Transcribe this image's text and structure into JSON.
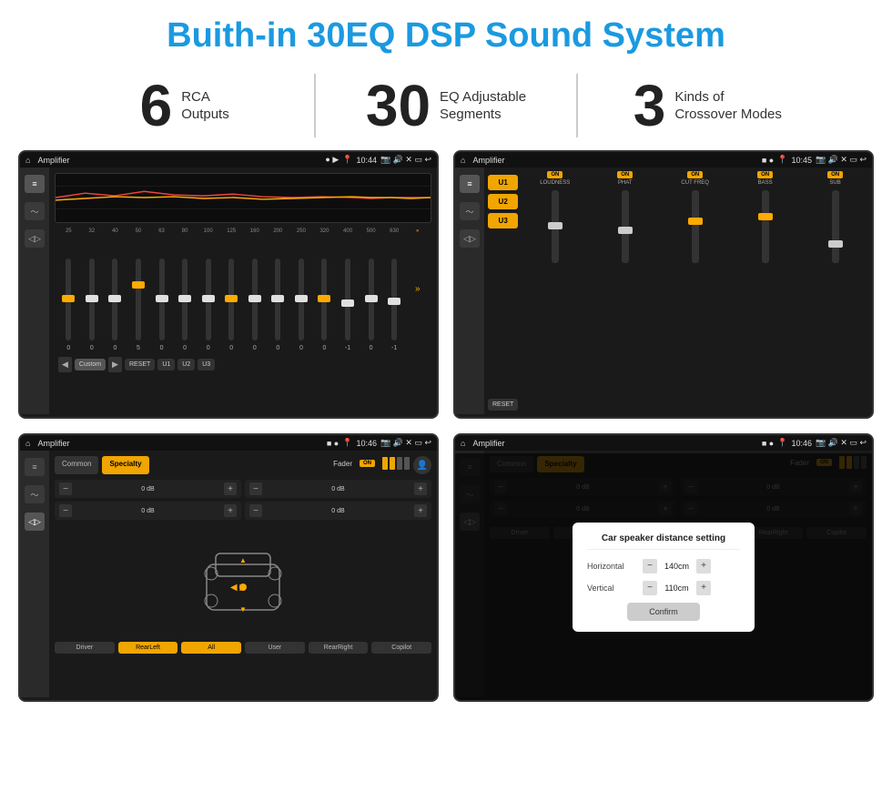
{
  "header": {
    "title": "Buith-in 30EQ DSP Sound System"
  },
  "stats": [
    {
      "number": "6",
      "label": "RCA\nOutputs"
    },
    {
      "number": "30",
      "label": "EQ Adjustable\nSegments"
    },
    {
      "number": "3",
      "label": "Kinds of\nCrossover Modes"
    }
  ],
  "screens": [
    {
      "id": "screen1",
      "status": {
        "title": "Amplifier",
        "time": "10:44"
      },
      "type": "eq"
    },
    {
      "id": "screen2",
      "status": {
        "title": "Amplifier",
        "time": "10:45"
      },
      "type": "crossover"
    },
    {
      "id": "screen3",
      "status": {
        "title": "Amplifier",
        "time": "10:46"
      },
      "type": "fader"
    },
    {
      "id": "screen4",
      "status": {
        "title": "Amplifier",
        "time": "10:46"
      },
      "type": "fader-dialog"
    }
  ],
  "eq": {
    "freqs": [
      "25",
      "32",
      "40",
      "50",
      "63",
      "80",
      "100",
      "125",
      "160",
      "200",
      "250",
      "320",
      "400",
      "500",
      "630"
    ],
    "vals": [
      "0",
      "0",
      "0",
      "5",
      "0",
      "0",
      "0",
      "0",
      "0",
      "0",
      "0",
      "0",
      "-1",
      "0",
      "-1"
    ],
    "slider_positions": [
      50,
      50,
      50,
      30,
      50,
      50,
      50,
      50,
      50,
      50,
      50,
      50,
      60,
      50,
      55
    ],
    "preset_labels": [
      "Custom",
      "RESET",
      "U1",
      "U2",
      "U3"
    ]
  },
  "crossover": {
    "presets": [
      "U1",
      "U2",
      "U3"
    ],
    "channels": [
      {
        "name": "LOUDNESS",
        "on": true
      },
      {
        "name": "PHAT",
        "on": true
      },
      {
        "name": "CUT FREQ",
        "on": true
      },
      {
        "name": "BASS",
        "on": true
      },
      {
        "name": "SUB",
        "on": true
      }
    ],
    "reset_label": "RESET"
  },
  "fader": {
    "tabs": [
      "Common",
      "Specialty"
    ],
    "active_tab": 1,
    "fader_label": "Fader",
    "on_label": "ON",
    "buttons": [
      "Driver",
      "RearLeft",
      "All",
      "User",
      "RearRight",
      "Copilot"
    ],
    "vol_values": [
      "0 dB",
      "0 dB",
      "0 dB",
      "0 dB"
    ]
  },
  "dialog": {
    "title": "Car speaker distance setting",
    "horizontal_label": "Horizontal",
    "horizontal_value": "140cm",
    "vertical_label": "Vertical",
    "vertical_value": "110cm",
    "confirm_label": "Confirm"
  }
}
